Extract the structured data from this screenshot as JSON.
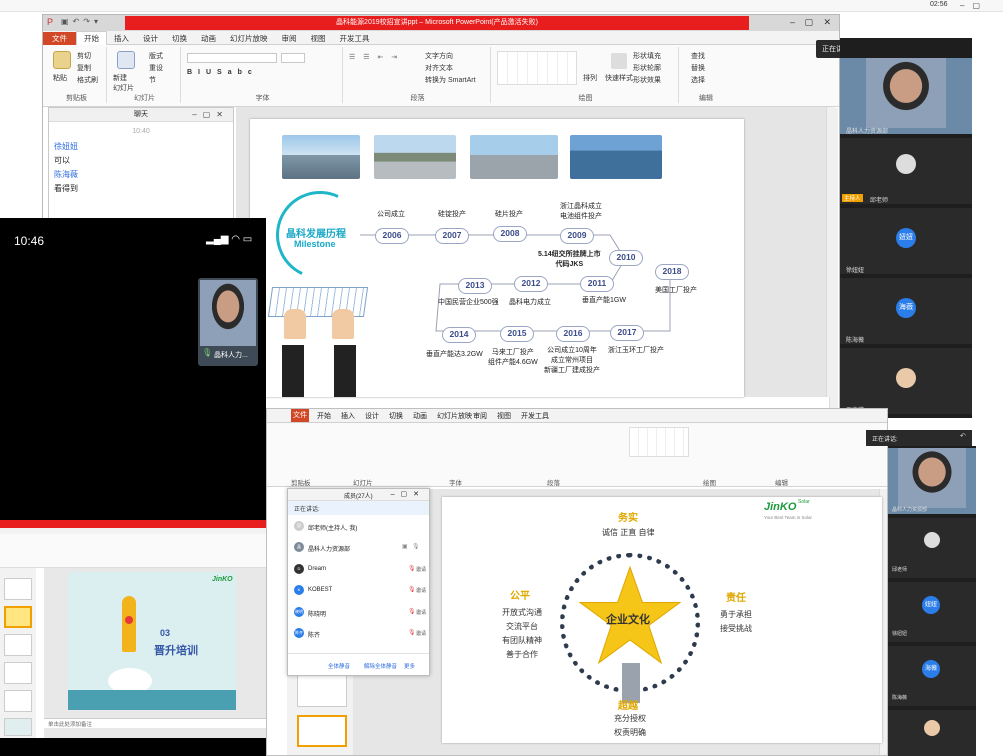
{
  "system": {
    "clock": "02:56"
  },
  "ppt1": {
    "title": "晶科能源2019校招宣讲ppt – Microsoft PowerPoint(产品激活失败)",
    "tabs": [
      "文件",
      "开始",
      "插入",
      "设计",
      "切换",
      "动画",
      "幻灯片放映",
      "审阅",
      "视图",
      "开发工具"
    ],
    "groups": {
      "clipboard": {
        "label": "剪贴板",
        "paste": "粘贴",
        "cut": "剪切",
        "copy": "复制",
        "format": "格式刷"
      },
      "slides": {
        "label": "幻灯片",
        "new": "新建\n幻灯片",
        "layout": "版式",
        "reset": "重设",
        "section": "节"
      },
      "font": {
        "label": "字体"
      },
      "paragraph": {
        "label": "段落",
        "dir": "文字方向",
        "align": "对齐文本",
        "smartart": "转换为 SmartArt"
      },
      "drawing": {
        "label": "绘图",
        "arrange": "排列",
        "quick": "快速样式",
        "fill": "形状填充",
        "outline": "形状轮廓",
        "effect": "形状效果"
      },
      "editing": {
        "label": "编辑",
        "find": "查找",
        "replace": "替换",
        "select": "选择"
      }
    }
  },
  "chat": {
    "title": "聊天",
    "time": "10:40",
    "messages": [
      {
        "name": "徐妞妞",
        "text": "可以"
      },
      {
        "name": "陈海薇",
        "text": "看得到"
      }
    ]
  },
  "slide1": {
    "heading": "晶科发展历程",
    "heading_en": "Milestone",
    "milestones": [
      {
        "year": "2006",
        "event": "公司成立"
      },
      {
        "year": "2007",
        "event": "硅锭投产"
      },
      {
        "year": "2008",
        "event": "硅片投产"
      },
      {
        "year": "2009",
        "event": "浙江晶科成立\n电池组件投产"
      },
      {
        "year": "2010",
        "event": "5.14纽交所挂牌上市\n代码JKS"
      },
      {
        "year": "2011",
        "event": "垂直产能1GW"
      },
      {
        "year": "2012",
        "event": "晶科电力成立"
      },
      {
        "year": "2013",
        "event": "中国民营企业500强"
      },
      {
        "year": "2014",
        "event": "垂直产能达3.2GW"
      },
      {
        "year": "2015",
        "event": "马来工厂投产\n组件产能4.6GW"
      },
      {
        "year": "2016",
        "event": "公司成立10周年\n成立常州项目\n新疆工厂建成投产"
      },
      {
        "year": "2017",
        "event": "浙江玉环工厂投产"
      },
      {
        "year": "2018",
        "event": "美国工厂投产"
      }
    ]
  },
  "meeting1": {
    "speaking_label": "正在讲话:",
    "tiles": [
      {
        "name": "晶科人力资源部",
        "kind": "video"
      },
      {
        "name": "邱老师",
        "kind": "cat",
        "host_badge": "主持人"
      },
      {
        "name": "徐妞妞",
        "kind": "avatar",
        "avatar": "妞妞"
      },
      {
        "name": "陈海薇",
        "kind": "avatar",
        "avatar": "海薇"
      },
      {
        "name": "至宝藏",
        "kind": "photo"
      }
    ]
  },
  "phone": {
    "time": "10:46",
    "tile_name": "晶科人力..."
  },
  "mini_ppt": {
    "slide_number": "03",
    "slide_title": "晋升培训",
    "notes": "单击此处添加备注",
    "logo": "JinKO"
  },
  "ppt2": {
    "tabs": [
      "文件",
      "开始",
      "插入",
      "设计",
      "切换",
      "动画",
      "幻灯片放映",
      "审阅",
      "视图",
      "开发工具"
    ],
    "groups": {
      "clipboard": "剪贴板",
      "slides": "幻灯片",
      "font": "字体",
      "paragraph": "段落",
      "drawing": "绘图",
      "editing": "编辑"
    }
  },
  "members": {
    "title": "成员(27人)",
    "speaking": "正在讲话:",
    "list": [
      {
        "name": "邱老师(主持人, 我)",
        "av": "邱"
      },
      {
        "name": "晶科人力资源部",
        "av": "晶"
      },
      {
        "name": "Dream",
        "av": "D"
      },
      {
        "name": "KOBEST",
        "av": "K"
      },
      {
        "name": "陈晓明",
        "av": "晓明"
      },
      {
        "name": "陈齐",
        "av": "陈齐"
      }
    ],
    "mute_label": "邀请",
    "buttons": {
      "mute_all": "全体静音",
      "unmute_all": "解除全体静音",
      "more": "更多"
    }
  },
  "slide2": {
    "logo": "JinKO",
    "logo_sub": "Solar",
    "tagline": "Your Best Team in Solar",
    "center": "企业文化",
    "top": {
      "title": "务实",
      "text": "诚信 正直 自律"
    },
    "left": {
      "title": "公平",
      "lines": [
        "开放式沟通",
        "交流平台",
        "有团队精神",
        "善于合作"
      ]
    },
    "right": {
      "title": "责任",
      "lines": [
        "勇于承担",
        "接受挑战"
      ]
    },
    "bottom": {
      "title": "超越",
      "lines": [
        "充分授权",
        "权责明确"
      ]
    }
  },
  "meeting2": {
    "speaking_label": "正在讲话:",
    "tiles": [
      {
        "name": "晶科人力资源部",
        "kind": "video"
      },
      {
        "name": "邱老师",
        "kind": "cat"
      },
      {
        "name": "徐妞妞",
        "kind": "avatar",
        "avatar": "妞妞"
      },
      {
        "name": "陈海薇",
        "kind": "avatar",
        "avatar": "海薇"
      }
    ]
  }
}
